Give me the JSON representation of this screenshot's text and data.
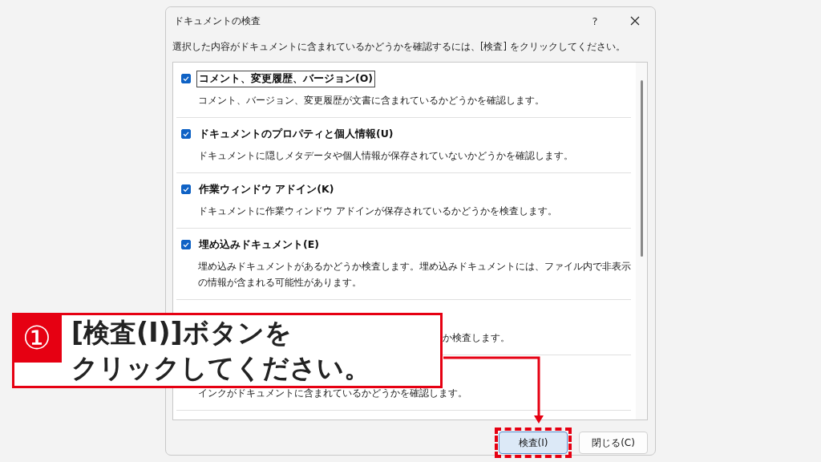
{
  "window": {
    "title": "ドキュメントの検査",
    "help": "?"
  },
  "instruction": "選択した内容がドキュメントに含まれているかどうかを確認するには、[検査] をクリックしてください。",
  "items": [
    {
      "label": "コメント、変更履歴、バージョン(O)",
      "description": "コメント、バージョン、変更履歴が文書に含まれているかどうかを確認します。",
      "checked": true,
      "focused": true
    },
    {
      "label": "ドキュメントのプロパティと個人情報(U)",
      "description": "ドキュメントに隠しメタデータや個人情報が保存されていないかどうかを確認します。",
      "checked": true,
      "focused": false
    },
    {
      "label": "作業ウィンドウ アドイン(K)",
      "description": "ドキュメントに作業ウィンドウ アドインが保存されているかどうかを検査します。",
      "checked": true,
      "focused": false
    },
    {
      "label": "埋め込みドキュメント(E)",
      "description": "埋め込みドキュメントがあるかどうか検査します。埋め込みドキュメントには、ファイル内で非表示の情報が含まれる可能性があります。",
      "checked": true,
      "focused": false
    },
    {
      "kind": "fragment",
      "description": "か検査します。"
    },
    {
      "kind": "plain",
      "description": "インクがドキュメントに含まれているかどうかを確認します。"
    }
  ],
  "buttons": [
    {
      "label": "検査(I)",
      "highlighted": true
    },
    {
      "label": "閉じる(C)",
      "highlighted": false
    }
  ],
  "callout": {
    "number": "①",
    "lines": [
      "[検査(I)]ボタンを",
      "クリックしてください。"
    ]
  }
}
